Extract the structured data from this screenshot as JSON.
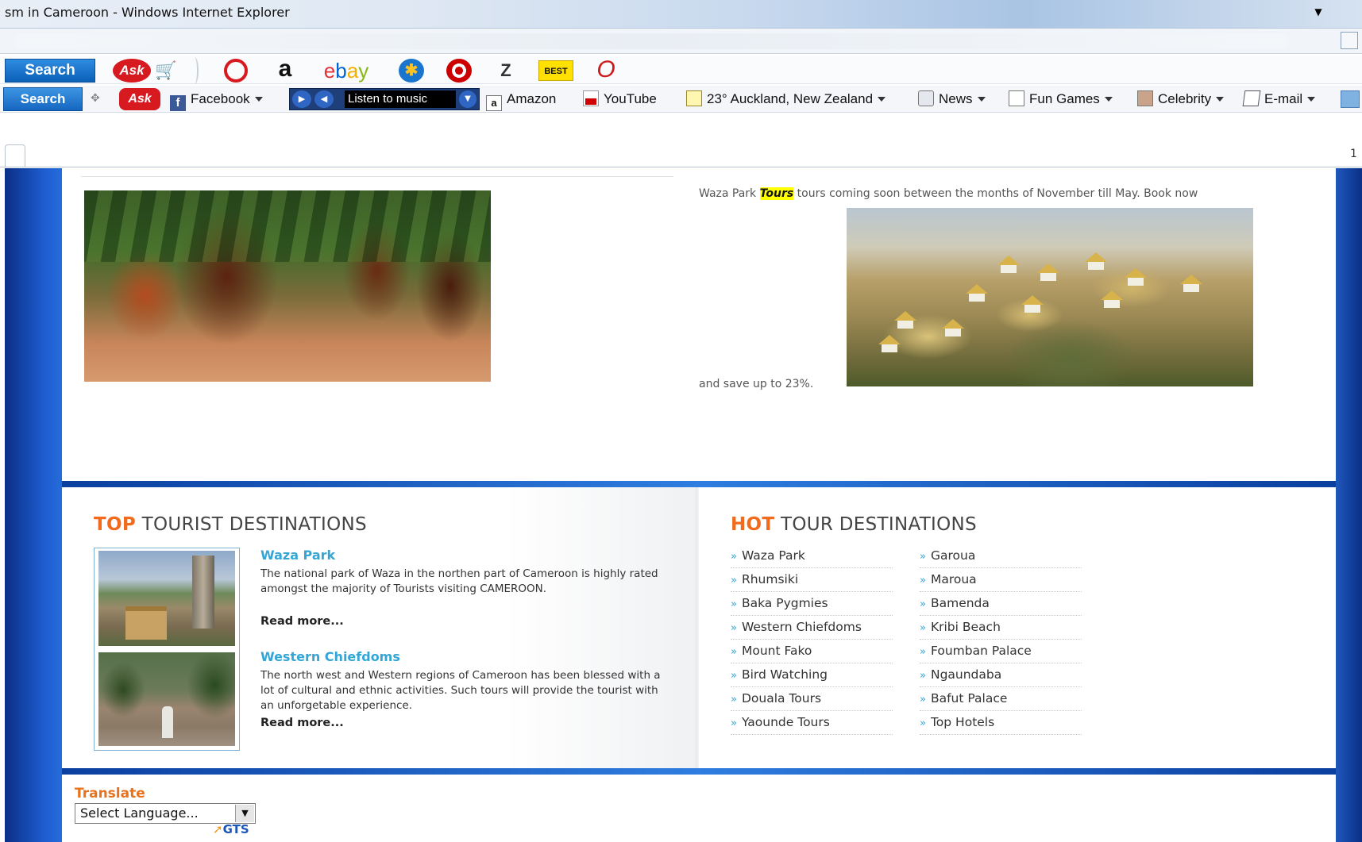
{
  "window": {
    "title": "sm in Cameroon - Windows Internet Explorer"
  },
  "toolbar1": {
    "search_label": "Search",
    "icons": [
      "ask-logo-icon",
      "shopping-cart-icon",
      "red-circle-logo-icon",
      "amazon-logo-icon",
      "ebay-logo-icon",
      "walmart-logo-icon",
      "target-logo-icon",
      "zappos-logo-icon",
      "bestbuy-logo-icon",
      "opera-logo-icon"
    ],
    "ask_text": "Ask",
    "amazon_text": "a",
    "ebay_text": "ebay",
    "zappos_text": "Z",
    "bestbuy_text": "BEST BUY"
  },
  "toolbar2": {
    "search_label": "Search",
    "ask_text": "Ask",
    "facebook": "Facebook",
    "music": "Listen to music",
    "amazon": "Amazon",
    "youtube": "YouTube",
    "weather": "23° Auckland, New Zealand",
    "news": "News",
    "fun_games": "Fun Games",
    "celebrity": "Celebrity",
    "email": "E-mail"
  },
  "tabs": {
    "count_text": "1"
  },
  "top_section": {
    "waza_text_before": "Waza Park ",
    "waza_highlight": "Tours",
    "waza_text_after": " tours coming soon between the months of November till May. Book now",
    "waza_text_end": "and save up to 23%."
  },
  "top_destinations": {
    "heading_accent": "TOP",
    "heading_rest": " TOURIST DESTINATIONS",
    "items": [
      {
        "title": "Waza Park",
        "desc": "The national park of Waza in the northen part of Cameroon is highly rated amongst the majority of Tourists visiting CAMEROON.",
        "more": "Read more..."
      },
      {
        "title": "Western Chiefdoms",
        "desc": "The north west and Western regions of Cameroon has been blessed with a lot of cultural and ethnic activities. Such tours will provide the tourist with an unforgetable experience.",
        "more": "Read more..."
      }
    ]
  },
  "hot_destinations": {
    "heading_accent": "HOT",
    "heading_rest": " TOUR DESTINATIONS",
    "bullet": "»",
    "col1": [
      "Waza Park",
      "Rhumsiki",
      "Baka Pygmies",
      "Western Chiefdoms",
      "Mount Fako",
      "Bird Watching",
      "Douala Tours",
      "Yaounde Tours"
    ],
    "col2": [
      "Garoua",
      "Maroua",
      "Bamenda",
      "Kribi Beach",
      "Foumban Palace",
      "Ngaundaba",
      "Bafut Palace",
      "Top Hotels"
    ]
  },
  "translate": {
    "label": "Translate",
    "select_value": "Select Language...",
    "gts": "GTS"
  },
  "colors": {
    "accent_orange": "#f26b1d",
    "link_blue": "#33a6d6",
    "band_blue": "#1550c0"
  }
}
